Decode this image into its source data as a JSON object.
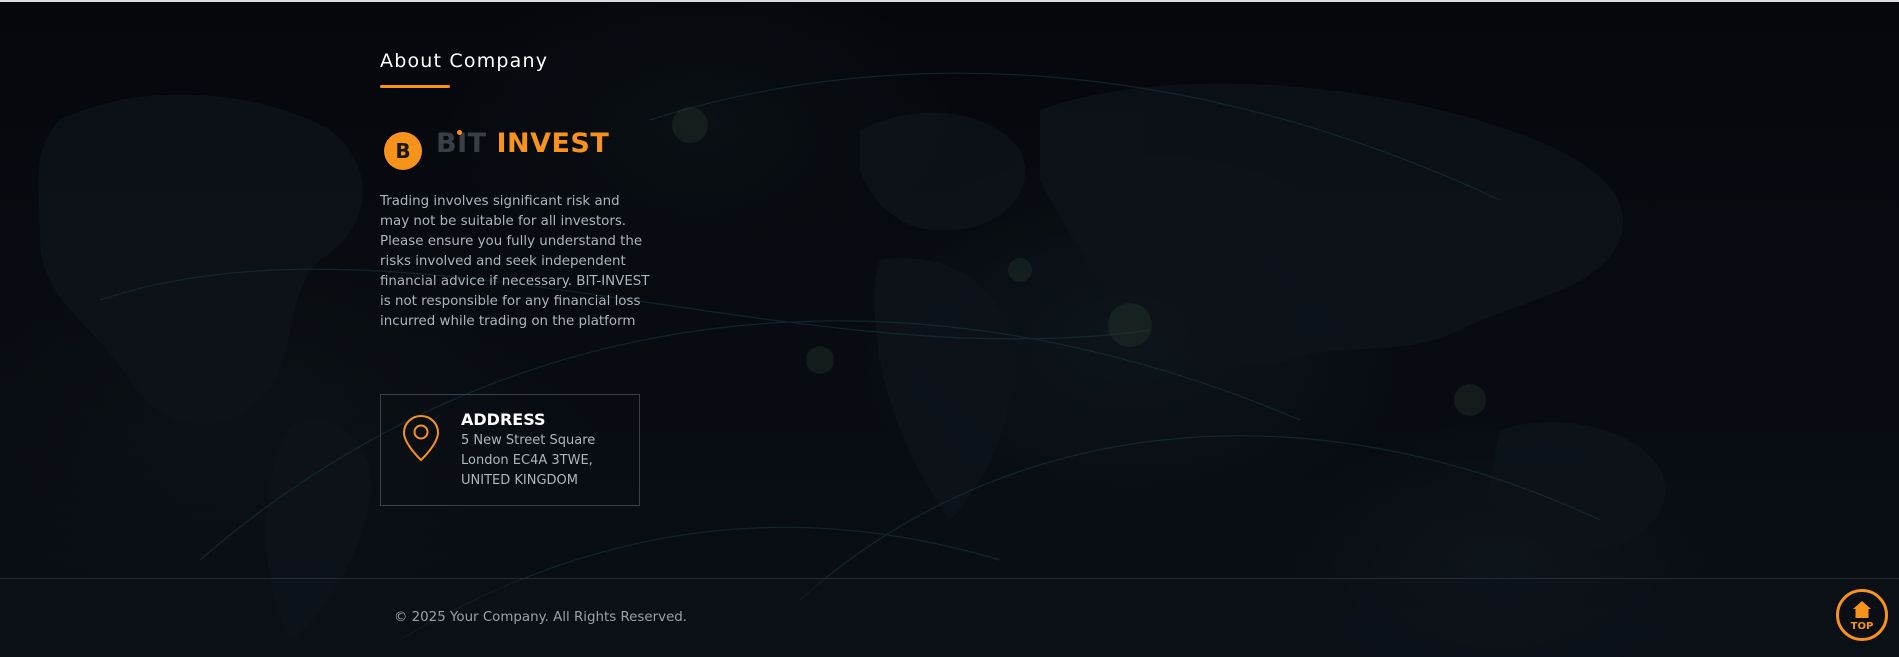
{
  "about": {
    "heading": "About Company",
    "logo": {
      "coin_symbol": "B",
      "text_part1": "BIT",
      "text_part2": "INVEST"
    },
    "disclaimer": "Trading involves significant risk and may not be suitable for all investors. Please ensure you fully understand the risks involved and seek independent financial advice if necessary. BIT-INVEST is not responsible for any financial loss incurred while trading on the platform"
  },
  "address": {
    "title": "ADDRESS",
    "line1": "5 New Street Square",
    "line2": "London EC4A 3TWE,",
    "line3": "UNITED KINGDOM"
  },
  "footer": {
    "copyright": "© 2025 Your Company. All Rights Reserved."
  },
  "top_button": {
    "label": "TOP"
  },
  "colors": {
    "accent": "#f7931a",
    "background": "#070a10",
    "text_muted": "#aeb4bd"
  },
  "icons": [
    "bitcoin-icon",
    "map-pin-icon",
    "home-icon"
  ]
}
